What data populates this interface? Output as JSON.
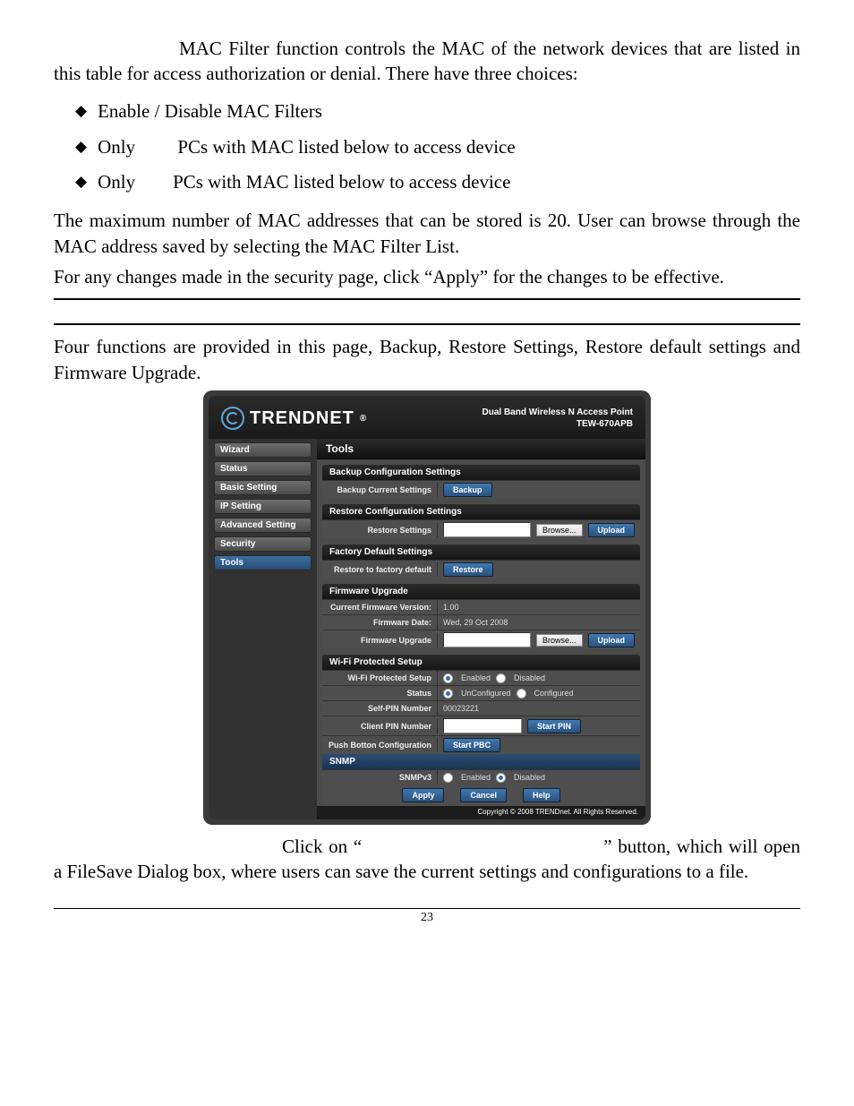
{
  "paras": {
    "p1": "MAC Filter function controls the MAC of the network devices that are listed in this table for access authorization or denial. There have three choices:",
    "b1": "Enable / Disable MAC Filters",
    "b2": "Only         PCs with MAC listed below to access device",
    "b3": "Only        PCs with MAC listed below to access device",
    "p2": "The maximum number of MAC addresses that can be stored is 20. User can browse through the MAC address saved by selecting the MAC Filter List.",
    "p3": "For any changes made in the security page, click “Apply” for the changes to be effective.",
    "p4": "Four functions are provided in this page, Backup, Restore Settings, Restore default settings and Firmware Upgrade.",
    "p5a": "Click on “",
    "p5b": "” button, which will open a FileSave Dialog box, where users can save the current settings and configurations to a file."
  },
  "router": {
    "brand": "TRENDNET",
    "subtitle1": "Dual Band Wireless N Access Point",
    "subtitle2": "TEW-670APB",
    "nav": {
      "wizard": "Wizard",
      "status": "Status",
      "basic": "Basic Setting",
      "ip": "IP Setting",
      "advanced": "Advanced Setting",
      "security": "Security",
      "tools": "Tools"
    },
    "title": "Tools",
    "backup": {
      "header": "Backup Configuration Settings",
      "label": "Backup Current Settings",
      "btn": "Backup"
    },
    "restore": {
      "header": "Restore Configuration Settings",
      "label": "Restore Settings",
      "browse": "Browse...",
      "upload": "Upload"
    },
    "factory": {
      "header": "Factory Default Settings",
      "label": "Restore to factory default",
      "btn": "Restore"
    },
    "fw": {
      "header": "Firmware Upgrade",
      "verLabel": "Current Firmware Version:",
      "verValue": "1.00",
      "dateLabel": "Firmware Date:",
      "dateValue": "Wed, 29 Oct 2008",
      "upLabel": "Firmware Upgrade",
      "browse": "Browse...",
      "upload": "Upload"
    },
    "wps": {
      "header": "Wi-Fi Protected Setup",
      "wpsLabel": "Wi-Fi Protected Setup",
      "enabled": "Enabled",
      "disabled": "Disabled",
      "statusLabel": "Status",
      "unconfigured": "UnConfigured",
      "configured": "Configured",
      "selfPinLabel": "Self-PIN Number",
      "selfPinValue": "00023221",
      "clientPinLabel": "Client PIN Number",
      "startPin": "Start PIN",
      "pbcLabel": "Push Botton Configuration",
      "startPbc": "Start PBC"
    },
    "snmp": {
      "header": "SNMP",
      "label": "SNMPv3",
      "enabled": "Enabled",
      "disabled": "Disabled"
    },
    "footer": {
      "apply": "Apply",
      "cancel": "Cancel",
      "help": "Help"
    },
    "copyright": "Copyright © 2008 TRENDnet. All Rights Reserved."
  },
  "pageNum": "23"
}
